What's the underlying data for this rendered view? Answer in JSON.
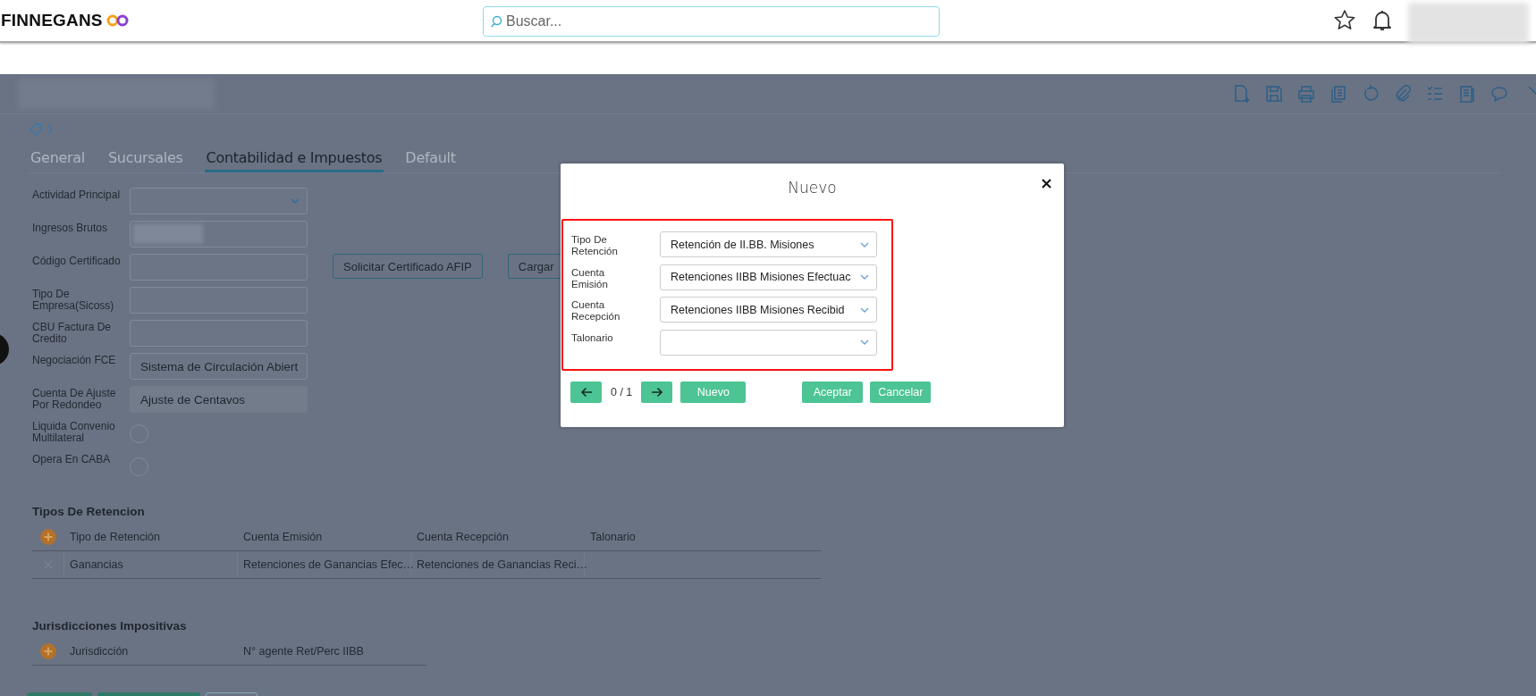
{
  "header": {
    "logo": "FINNEGANS",
    "search": {
      "placeholder": "Buscar..."
    }
  },
  "tabs": [
    {
      "label": "General",
      "selected": false
    },
    {
      "label": "Sucursales",
      "selected": false
    },
    {
      "label": "Contabilidad e Impuestos",
      "selected": true
    },
    {
      "label": "Default",
      "selected": false
    }
  ],
  "form": {
    "fields": [
      {
        "label": "Actividad Principal",
        "kind": "select"
      },
      {
        "label": "Ingresos Brutos",
        "kind": "blurred"
      },
      {
        "label": "Código Certificado",
        "kind": "text"
      },
      {
        "label": "Tipo De Empresa(Sicoss)",
        "kind": "text"
      },
      {
        "label": "CBU Factura De Credito",
        "kind": "text"
      },
      {
        "label": "Negociación FCE",
        "kind": "text",
        "value": "Sistema de Circulación Abiert"
      },
      {
        "label": "Cuenta De Ajuste Por Redondeo",
        "kind": "text",
        "value": "Ajuste de Centavos",
        "disabled": true
      },
      {
        "label": "Liquida Convenio Multilateral",
        "kind": "checkbox",
        "checked": false
      },
      {
        "label": "Opera En CABA",
        "kind": "checkbox",
        "checked": false
      }
    ],
    "buttons": [
      "Solicitar Certificado AFIP",
      "Cargar"
    ]
  },
  "retenciones": {
    "title": "Tipos De Retencion",
    "columns": [
      "Tipo de Retención",
      "Cuenta Emisión",
      "Cuenta Recepción",
      "Talonario"
    ],
    "rows": [
      {
        "cells": [
          "Ganancias",
          "Retenciones de Ganancias Efec…",
          "Retenciones de Ganancias Reci…",
          ""
        ]
      }
    ]
  },
  "jurisdicciones": {
    "title": "Jurisdicciones Impositivas",
    "columns": [
      "Jurisdicción",
      "N° agente Ret/Perc IIBB"
    ]
  },
  "modal": {
    "title": "Nuevo",
    "fields": [
      {
        "label": "Tipo De Retención",
        "value": "Retención de II.BB. Misiones"
      },
      {
        "label": "Cuenta Emisión",
        "value": "Retenciones IIBB Misiones Efectuac"
      },
      {
        "label": "Cuenta Recepción",
        "value": "Retenciones IIBB Misiones Recibid"
      },
      {
        "label": "Talonario"
      }
    ],
    "counter": "0 / 1",
    "buttons": [
      {
        "label": "Nuevo",
        "kind": "new"
      },
      {
        "label": "Aceptar",
        "kind": "ok"
      },
      {
        "label": "Cancelar",
        "kind": "cancel"
      }
    ]
  }
}
